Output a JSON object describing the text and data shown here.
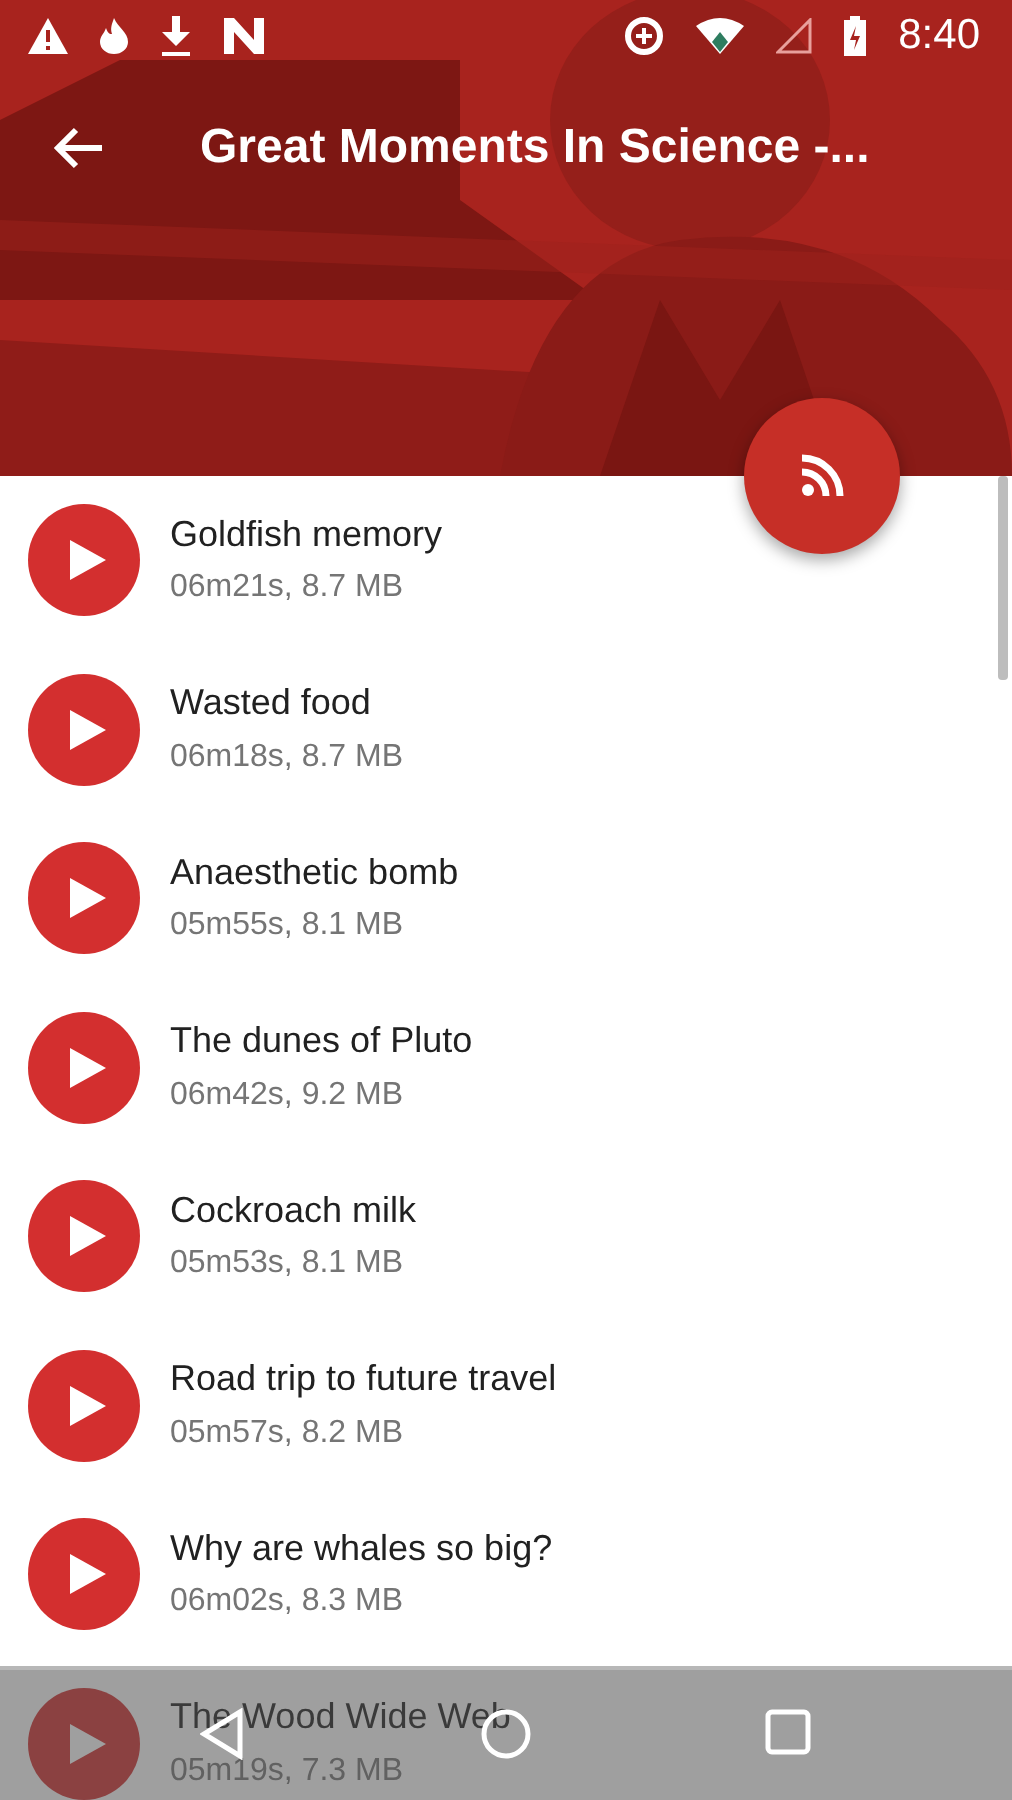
{
  "status_bar": {
    "time": "8:40"
  },
  "toolbar": {
    "title": "Great Moments In Science -..."
  },
  "episodes": [
    {
      "title": "Goldfish memory",
      "details": "06m21s, 8.7 MB"
    },
    {
      "title": "Wasted food",
      "details": "06m18s, 8.7 MB"
    },
    {
      "title": "Anaesthetic bomb",
      "details": "05m55s, 8.1 MB"
    },
    {
      "title": "The dunes of Pluto",
      "details": "06m42s, 9.2 MB"
    },
    {
      "title": "Cockroach milk",
      "details": "05m53s, 8.1 MB"
    },
    {
      "title": "Road trip to future travel",
      "details": "05m57s, 8.2 MB"
    },
    {
      "title": "Why are whales so big?",
      "details": "06m02s, 8.3 MB"
    },
    {
      "title": "The Wood Wide Web",
      "details": "05m19s, 7.3 MB"
    }
  ]
}
